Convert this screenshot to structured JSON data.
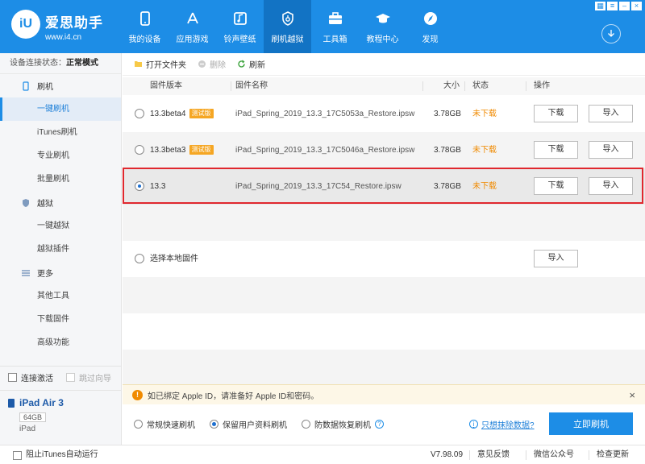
{
  "header": {
    "brand_name": "爱思助手",
    "brand_url": "www.i4.cn",
    "logo_text": "iU",
    "nav": [
      {
        "label": "我的设备",
        "icon": "phone-icon"
      },
      {
        "label": "应用游戏",
        "icon": "app-store-icon"
      },
      {
        "label": "铃声壁纸",
        "icon": "music-icon"
      },
      {
        "label": "刷机越狱",
        "icon": "flash-icon",
        "active": true
      },
      {
        "label": "工具箱",
        "icon": "toolbox-icon"
      },
      {
        "label": "教程中心",
        "icon": "graduation-cap-icon"
      },
      {
        "label": "发现",
        "icon": "compass-icon"
      }
    ]
  },
  "sidebar": {
    "status_label": "设备连接状态：",
    "status_value": "正常模式",
    "sections": [
      {
        "label": "刷机",
        "icon": "phone-flash-icon",
        "items": [
          "一键刷机",
          "iTunes刷机",
          "专业刷机",
          "批量刷机"
        ]
      },
      {
        "label": "越狱",
        "icon": "shield-icon",
        "items": [
          "一键越狱",
          "越狱插件"
        ]
      },
      {
        "label": "更多",
        "icon": "menu-icon",
        "items": [
          "其他工具",
          "下载固件",
          "高级功能"
        ]
      }
    ],
    "active_item": "一键刷机",
    "connect_activate": "连接激活",
    "skip_guide": "跳过向导",
    "device": {
      "name": "iPad Air 3",
      "capacity": "64GB",
      "type": "iPad"
    }
  },
  "toolbar": {
    "open_folder": "打开文件夹",
    "delete": "删除",
    "refresh": "刷新"
  },
  "table": {
    "columns": [
      "固件版本",
      "固件名称",
      "大小",
      "状态",
      "操作"
    ],
    "rows": [
      {
        "version": "13.3beta4",
        "badge": "测试版",
        "name": "iPad_Spring_2019_13.3_17C5053a_Restore.ipsw",
        "size": "3.78GB",
        "status": "未下载"
      },
      {
        "version": "13.3beta3",
        "badge": "测试版",
        "name": "iPad_Spring_2019_13.3_17C5046a_Restore.ipsw",
        "size": "3.78GB",
        "status": "未下载"
      },
      {
        "version": "13.3",
        "badge": "",
        "name": "iPad_Spring_2019_13.3_17C54_Restore.ipsw",
        "size": "3.78GB",
        "status": "未下载",
        "selected": true
      }
    ],
    "download_label": "下载",
    "import_label": "导入",
    "local_label": "选择本地固件"
  },
  "notice": {
    "text": "如已绑定 Apple ID，请准备好 Apple ID和密码。",
    "close": "×"
  },
  "modes": {
    "options": [
      "常规快速刷机",
      "保留用户资料刷机",
      "防数据恢复刷机"
    ],
    "selected": "保留用户资料刷机",
    "help": "?",
    "erase_link": "只想抹除数据?",
    "flash_button": "立即刷机"
  },
  "footer": {
    "block_itunes": "阻止iTunes自动运行",
    "version": "V7.98.09",
    "feedback": "意见反馈",
    "wechat": "微信公众号",
    "check_update": "检查更新"
  }
}
